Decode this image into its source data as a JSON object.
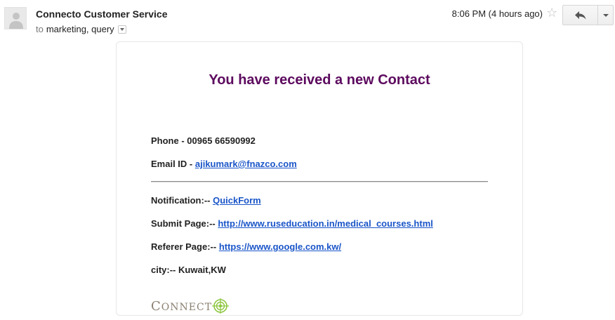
{
  "header": {
    "sender": "Connecto Customer Service",
    "to_prefix": "to",
    "recipients": "marketing, query",
    "timestamp": "8:06 PM (4 hours ago)",
    "star_glyph": "☆"
  },
  "email": {
    "title": "You have received a new Contact",
    "phone_label": "Phone - ",
    "phone_value": "00965 66590992",
    "email_label": "Email ID - ",
    "email_value": "ajikumark@fnazco.com",
    "notification_label": "Notification:-- ",
    "notification_value": "QuickForm",
    "submit_label": "Submit Page:-- ",
    "submit_value": "http://www.ruseducation.in/medical_courses.html",
    "referer_label": "Referer Page:-- ",
    "referer_value": "https://www.google.com.kw/",
    "city_label": "city:-- ",
    "city_value": "Kuwait,KW",
    "logo_first": "C",
    "logo_rest": "ONNECT"
  },
  "colors": {
    "title": "#5c0a5e",
    "link": "#1a55c8",
    "logo_text": "#8a7f70",
    "logo_target": "#8dc63f"
  },
  "icons": {
    "avatar": "person-silhouette-icon",
    "star": "star-outline-icon",
    "reply": "reply-arrow-icon",
    "more": "chevron-down-icon",
    "details": "chevron-down-icon",
    "logo_mark": "target-icon"
  }
}
